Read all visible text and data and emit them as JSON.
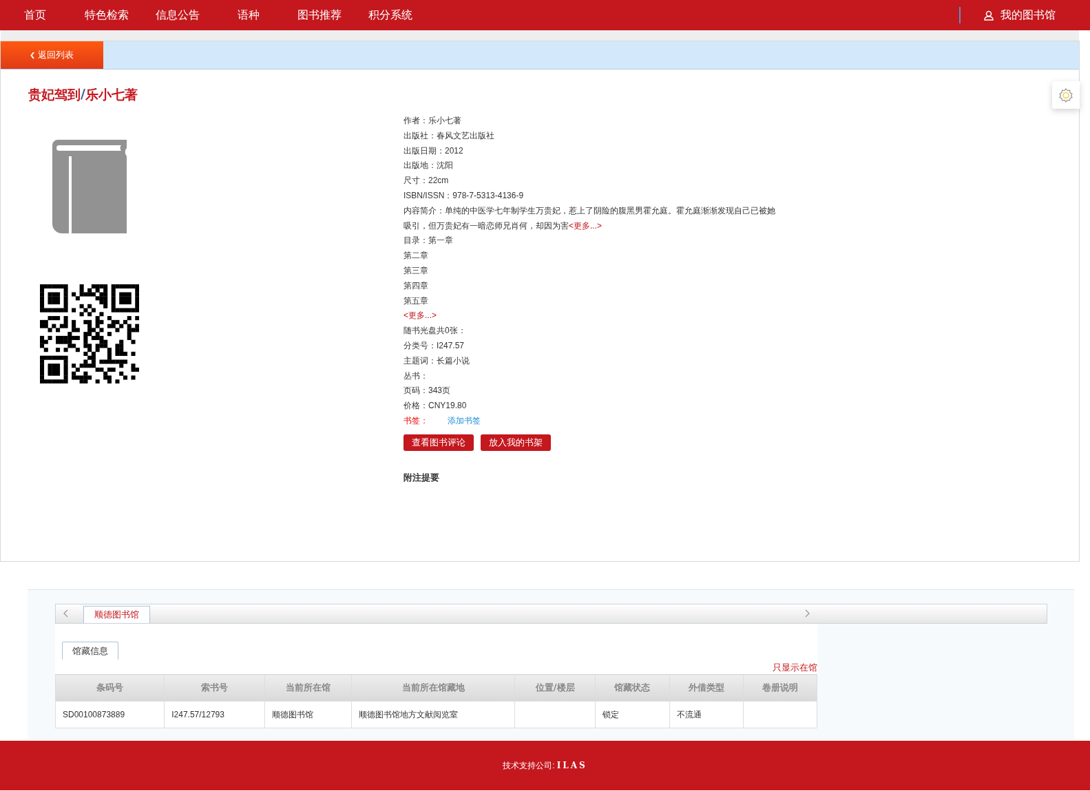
{
  "nav": {
    "items": [
      {
        "label": "首页"
      },
      {
        "label": "特色检索"
      },
      {
        "label": "信息公告"
      },
      {
        "label": "语种"
      },
      {
        "label": "图书推荐"
      },
      {
        "label": "积分系统"
      }
    ],
    "account": "我的图书馆"
  },
  "back_button": "返回列表",
  "title": {
    "name": "贵妃驾到",
    "separator": "/",
    "author": "乐小七著"
  },
  "details": [
    {
      "kind": "field",
      "label": "作者：",
      "value": "乐小七著"
    },
    {
      "kind": "field",
      "label": "出版社：",
      "value": "春风文艺出版社"
    },
    {
      "kind": "field",
      "label": "出版日期：",
      "value": "2012"
    },
    {
      "kind": "field",
      "label": "出版地：",
      "value": "沈阳"
    },
    {
      "kind": "field",
      "label": "尺寸：",
      "value": "22cm"
    },
    {
      "kind": "field",
      "label": "ISBN/ISSN：",
      "value": "978-7-5313-4136-9"
    },
    {
      "kind": "summary",
      "label": "内容简介：",
      "value": "单纯的中医学七年制学生万贵妃，惹上了阴险的腹黑男霍允庭。霍允庭渐渐发现自己已被她吸引，但万贵妃有一暗恋师兄肖何，却因为害",
      "more": "<更多...>"
    },
    {
      "kind": "contents",
      "label": "目录：",
      "items": [
        "第一章",
        "第二章",
        "第三章",
        "第四章",
        "第五章"
      ],
      "more": "<更多...>"
    },
    {
      "kind": "label",
      "label": "随书光盘共0张："
    },
    {
      "kind": "field",
      "label": "分类号：",
      "value": "I247.57"
    },
    {
      "kind": "field",
      "label": "主题词：",
      "value": "长篇小说"
    },
    {
      "kind": "label",
      "label": "丛书："
    },
    {
      "kind": "field",
      "label": "页码：",
      "value": "343页"
    },
    {
      "kind": "field",
      "label": "价格：",
      "value": "CNY19.80"
    },
    {
      "kind": "bookmark",
      "label": "书签：",
      "link": "添加书签"
    }
  ],
  "actions": [
    "查看图书评论",
    "放入我的书架"
  ],
  "notes_heading": "附注提要",
  "holdings": {
    "library_tabs": [
      {
        "label": "顺德图书馆",
        "selected": true
      }
    ],
    "sub_tabs": [
      {
        "label": "馆藏信息",
        "selected": true
      }
    ],
    "filter_link": "只显示在馆",
    "columns": [
      "条码号",
      "索书号",
      "当前所在馆",
      "当前所在馆藏地",
      "位置/楼层",
      "馆藏状态",
      "外借类型",
      "卷册说明"
    ],
    "rows": [
      [
        "SD00100873889",
        "I247.57/12793",
        "顺德图书馆",
        "顺德图书馆地方文献阅览室",
        null,
        "锁定",
        "不流通",
        null
      ]
    ]
  },
  "footer": {
    "label": "技术支持公司:",
    "company": "ILAS"
  }
}
